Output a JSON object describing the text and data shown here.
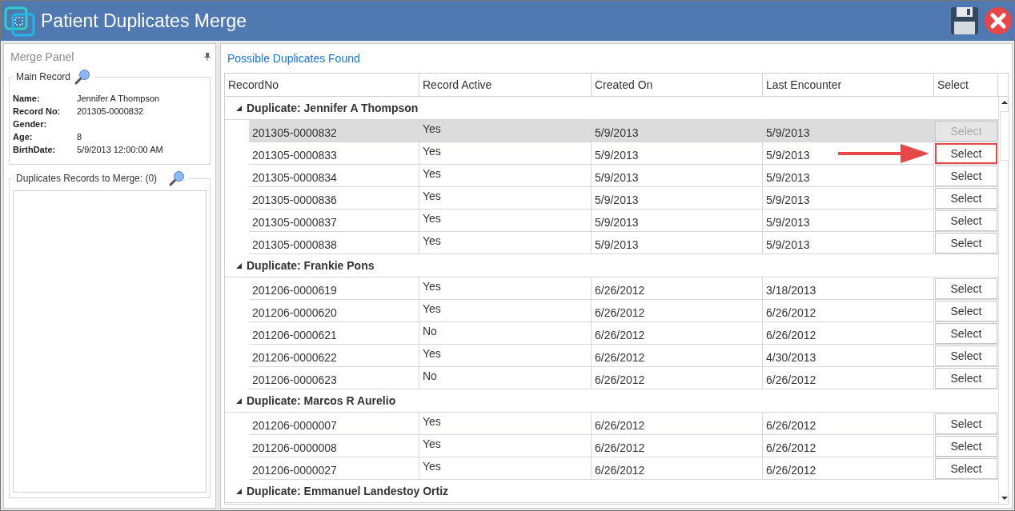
{
  "window": {
    "title": "Patient Duplicates Merge"
  },
  "merge_panel": {
    "title": "Merge Panel",
    "main_record": {
      "legend": "Main Record",
      "fields": [
        {
          "label": "Name:",
          "value": "Jennifer A Thompson"
        },
        {
          "label": "Record No:",
          "value": "201305-0000832"
        },
        {
          "label": "Gender:"
        },
        {
          "label": "Age:",
          "value": "8"
        },
        {
          "label": "BirthDate:",
          "value": "5/9/2013 12:00:00 AM"
        }
      ]
    },
    "duplicates_to_merge": {
      "legend": "Duplicates Records to Merge: (0)"
    }
  },
  "duplicates": {
    "title": "Possible Duplicates Found",
    "columns": [
      "RecordNo",
      "Record Active",
      "Created On",
      "Last Encounter",
      "Select"
    ],
    "groups": [
      {
        "title": "Duplicate: Jennifer A Thompson",
        "expanded": true,
        "rows": [
          {
            "record_no": "201305-0000832",
            "active": "Yes",
            "created": "5/9/2013",
            "last": "5/9/2013",
            "button": "Select",
            "selected": true,
            "disabled": true,
            "callout": false
          },
          {
            "record_no": "201305-0000833",
            "active": "Yes",
            "created": "5/9/2013",
            "last": "5/9/2013",
            "button": "Select",
            "selected": false,
            "disabled": false,
            "callout": true
          },
          {
            "record_no": "201305-0000834",
            "active": "Yes",
            "created": "5/9/2013",
            "last": "5/9/2013",
            "button": "Select",
            "selected": false,
            "disabled": false,
            "callout": false
          },
          {
            "record_no": "201305-0000836",
            "active": "Yes",
            "created": "5/9/2013",
            "last": "5/9/2013",
            "button": "Select",
            "selected": false,
            "disabled": false,
            "callout": false
          },
          {
            "record_no": "201305-0000837",
            "active": "Yes",
            "created": "5/9/2013",
            "last": "5/9/2013",
            "button": "Select",
            "selected": false,
            "disabled": false,
            "callout": false
          },
          {
            "record_no": "201305-0000838",
            "active": "Yes",
            "created": "5/9/2013",
            "last": "5/9/2013",
            "button": "Select",
            "selected": false,
            "disabled": false,
            "callout": false
          }
        ]
      },
      {
        "title": "Duplicate: Frankie Pons",
        "expanded": true,
        "rows": [
          {
            "record_no": "201206-0000619",
            "active": "Yes",
            "created": "6/26/2012",
            "last": "3/18/2013",
            "button": "Select",
            "selected": false,
            "disabled": false,
            "callout": false
          },
          {
            "record_no": "201206-0000620",
            "active": "Yes",
            "created": "6/26/2012",
            "last": "6/26/2012",
            "button": "Select",
            "selected": false,
            "disabled": false,
            "callout": false
          },
          {
            "record_no": "201206-0000621",
            "active": "No",
            "created": "6/26/2012",
            "last": "6/26/2012",
            "button": "Select",
            "selected": false,
            "disabled": false,
            "callout": false
          },
          {
            "record_no": "201206-0000622",
            "active": "Yes",
            "created": "6/26/2012",
            "last": "4/30/2013",
            "button": "Select",
            "selected": false,
            "disabled": false,
            "callout": false
          },
          {
            "record_no": "201206-0000623",
            "active": "No",
            "created": "6/26/2012",
            "last": "6/26/2012",
            "button": "Select",
            "selected": false,
            "disabled": false,
            "callout": false
          }
        ]
      },
      {
        "title": "Duplicate: Marcos R Aurelio",
        "expanded": true,
        "rows": [
          {
            "record_no": "201206-0000007",
            "active": "Yes",
            "created": "6/26/2012",
            "last": "6/26/2012",
            "button": "Select",
            "selected": false,
            "disabled": false,
            "callout": false
          },
          {
            "record_no": "201206-0000008",
            "active": "Yes",
            "created": "6/26/2012",
            "last": "6/26/2012",
            "button": "Select",
            "selected": false,
            "disabled": false,
            "callout": false
          },
          {
            "record_no": "201206-0000027",
            "active": "Yes",
            "created": "6/26/2012",
            "last": "6/26/2012",
            "button": "Select",
            "selected": false,
            "disabled": false,
            "callout": false
          }
        ]
      },
      {
        "title": "Duplicate: Emmanuel Landestoy Ortiz",
        "expanded": true
      }
    ]
  }
}
